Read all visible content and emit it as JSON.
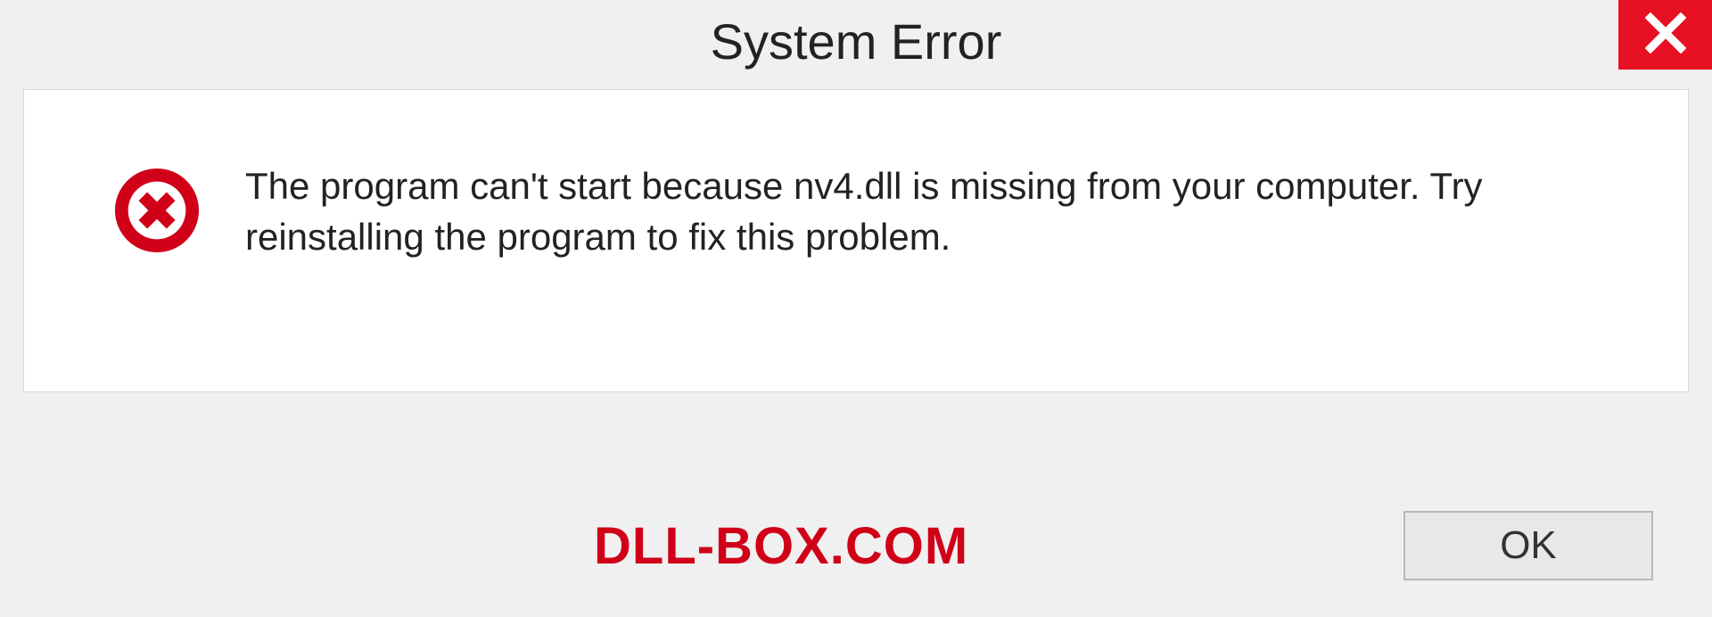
{
  "window": {
    "title": "System Error"
  },
  "dialog": {
    "message": "The program can't start because nv4.dll is missing from your computer. Try reinstalling the program to fix this problem."
  },
  "footer": {
    "watermark": "DLL-BOX.COM",
    "ok_label": "OK"
  },
  "colors": {
    "close_bg": "#e81123",
    "error_icon": "#d00018",
    "watermark": "#d00018"
  }
}
